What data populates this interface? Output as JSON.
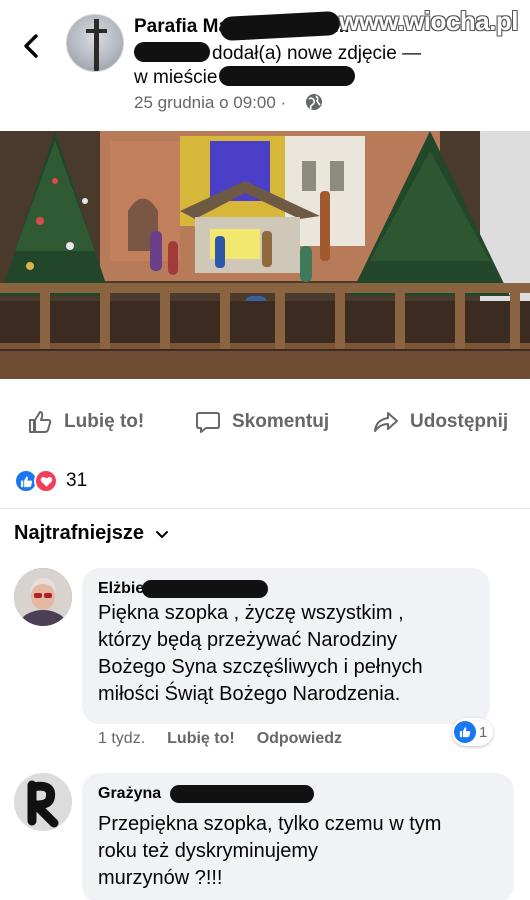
{
  "header": {
    "page_name": "Parafia Matki Bożej Mi...",
    "post_action": "dodał(a) nowe zdjęcie —",
    "location_prefix": "w mieście",
    "date": "25 grudnia o 09:00 ·",
    "watermark": "www.wiocha.pl"
  },
  "actions": {
    "like": "Lubię to!",
    "comment": "Skomentuj",
    "share": "Udostępnij"
  },
  "reactions": {
    "count": "31"
  },
  "sort": {
    "label": "Najtrafniejsze"
  },
  "comments": [
    {
      "author": "Elżbieta",
      "lines": [
        "Piękna szopka , życzę wszystkim ,",
        "którzy będą przeżywać Narodziny",
        "Bożego Syna szczęśliwych i pełnych",
        "miłości Świąt Bożego Narodzenia."
      ],
      "time": "1 tydz.",
      "like_label": "Lubię to!",
      "reply_label": "Odpowiedz",
      "reaction_count": "1"
    },
    {
      "author": "Grażyna",
      "lines": [
        "Przepiękna szopka, tylko czemu w tym",
        "roku też dyskryminujemy",
        "murzynów ?!!!"
      ]
    }
  ],
  "colors": {
    "fb_blue": "#1877f2",
    "love_red": "#f33e58",
    "secondary_text": "#65676b",
    "bubble_bg": "#f0f2f5"
  }
}
